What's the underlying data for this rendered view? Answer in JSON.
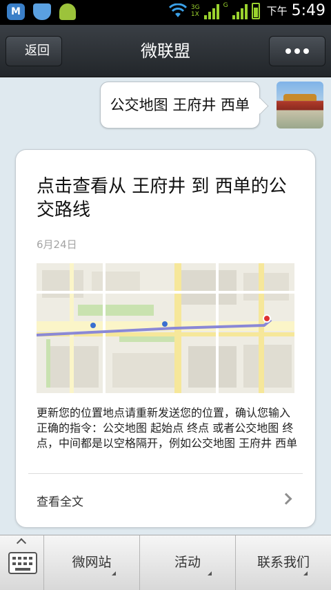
{
  "status_bar": {
    "notification_icons": [
      "m-app-icon",
      "shield-icon",
      "android-icon"
    ],
    "network_labels": [
      "3G",
      "1X",
      "G"
    ],
    "time_prefix": "下午",
    "time": "5:49",
    "accent_color": "#9ad22e"
  },
  "header": {
    "back_label": "返回",
    "title": "微联盟",
    "more_icon": "more-dots-icon"
  },
  "chat": {
    "sent_message": "公交地图 王府井 西单",
    "card": {
      "title": "点击查看从 王府井 到 西单的公交路线",
      "date": "6月24日",
      "description": "更新您的位置地点请重新发送您的位置，确认您输入正确的指令：公交地图 起始点 终点 或者公交地图  终点，中间都是以空格隔开，例如公交地图 王府井 西单",
      "read_more_label": "查看全文"
    }
  },
  "bottom_bar": {
    "keyboard_icon": "keyboard-icon",
    "menus": [
      {
        "label": "微网站"
      },
      {
        "label": "活动"
      },
      {
        "label": "联系我们"
      }
    ]
  }
}
